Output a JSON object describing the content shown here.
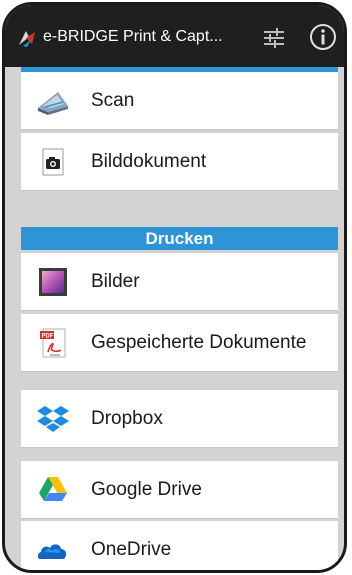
{
  "appbar": {
    "title": "e-BRIDGE Print & Capt...",
    "icons": {
      "app": "e-bridge-app-icon",
      "settings": "sliders-icon",
      "info": "info-icon"
    }
  },
  "scan_section": {
    "items": [
      {
        "label": "Scan",
        "icon": "scanner-icon"
      },
      {
        "label": "Bilddokument",
        "icon": "camera-icon"
      }
    ]
  },
  "print_section": {
    "header": "Drucken",
    "items": [
      {
        "label": "Bilder",
        "icon": "picture-icon"
      },
      {
        "label": "Gespeicherte Dokumente",
        "icon": "pdf-icon"
      },
      {
        "label": "Dropbox",
        "icon": "dropbox-icon"
      },
      {
        "label": "Google Drive",
        "icon": "google-drive-icon"
      },
      {
        "label": "OneDrive",
        "icon": "onedrive-icon"
      }
    ]
  },
  "colors": {
    "accent": "#2d94d6",
    "appbar": "#1f1f1f",
    "background": "#d2d3d5"
  }
}
